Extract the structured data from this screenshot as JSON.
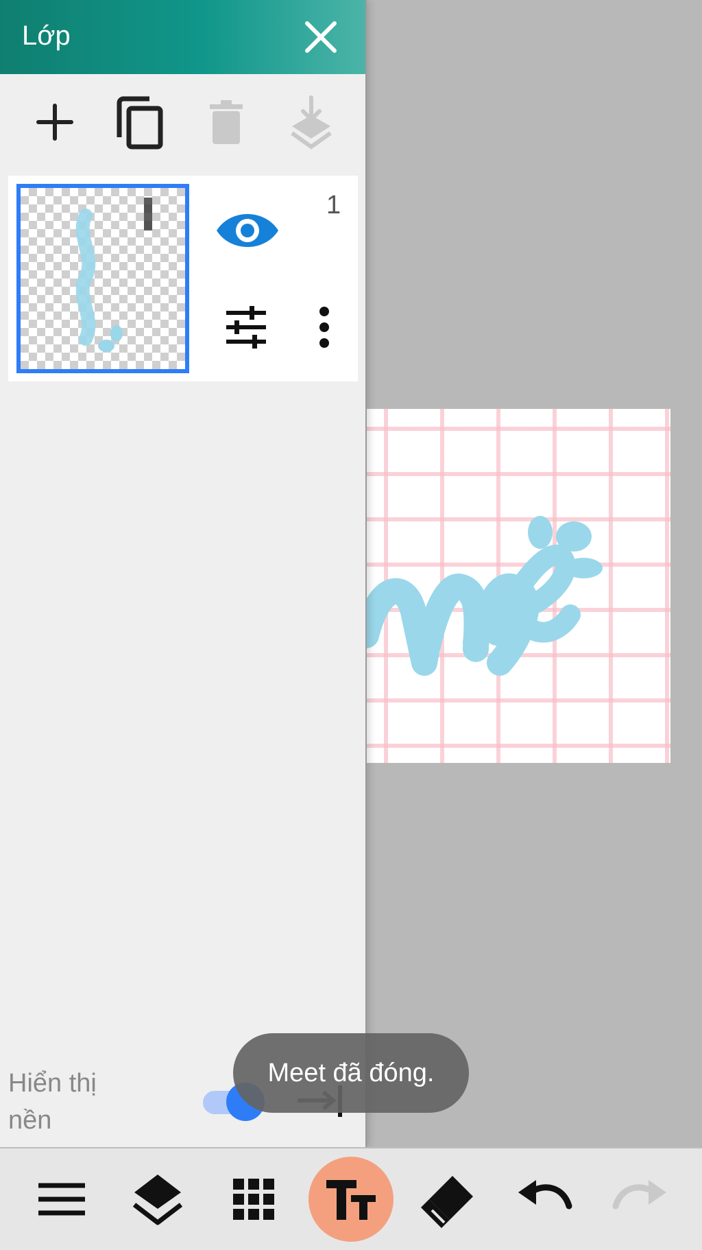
{
  "panel": {
    "title": "Lớp",
    "close_icon": "close-icon",
    "toolbar": [
      {
        "name": "add-layer-button",
        "icon": "plus-icon",
        "enabled": true
      },
      {
        "name": "duplicate-layer-button",
        "icon": "copy-icon",
        "enabled": true
      },
      {
        "name": "delete-layer-button",
        "icon": "trash-icon",
        "enabled": false
      },
      {
        "name": "merge-down-button",
        "icon": "merge-down-icon",
        "enabled": false
      }
    ]
  },
  "layer": {
    "number": "1",
    "visible": true,
    "selected": true
  },
  "background_toggle": {
    "label": "Hiển thị nền",
    "on": true
  },
  "toast": {
    "message": "Meet đã đóng."
  },
  "canvas": {
    "artwork_text": "me"
  },
  "bottom_toolbar": [
    {
      "name": "menu-button",
      "icon": "menu-icon"
    },
    {
      "name": "layers-button",
      "icon": "layers-icon"
    },
    {
      "name": "grid-button",
      "icon": "grid-icon"
    },
    {
      "name": "text-tool-button",
      "icon": "text-icon",
      "active": true
    },
    {
      "name": "eraser-button",
      "icon": "eraser-icon"
    },
    {
      "name": "undo-button",
      "icon": "undo-icon"
    },
    {
      "name": "redo-button",
      "icon": "redo-icon",
      "enabled": false
    }
  ],
  "colors": {
    "header_teal": "#10968a",
    "accent_blue": "#2f7df6",
    "text_tool_active": "#f4a07e",
    "artwork_blue": "#9ad7ea",
    "grid_pink": "#f8bec8"
  }
}
